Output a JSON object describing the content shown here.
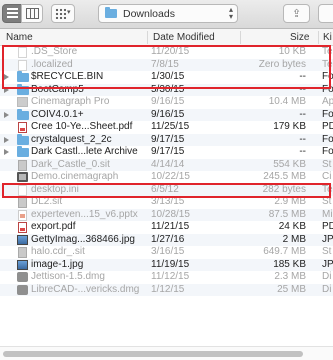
{
  "toolbar": {
    "location": "Downloads"
  },
  "columns": {
    "name": "Name",
    "date": "Date Modified",
    "size": "Size",
    "kind": "Ki"
  },
  "rows": [
    {
      "name": ".DS_Store",
      "date": "11/20/15",
      "size": "10 KB",
      "kind": "Te",
      "icon": "document-icon",
      "dim": true
    },
    {
      "name": ".localized",
      "date": "7/8/15",
      "size": "Zero bytes",
      "kind": "Te",
      "icon": "document-icon",
      "dim": true
    },
    {
      "name": "$RECYCLE.BIN",
      "date": "1/30/15",
      "size": "--",
      "kind": "Fo",
      "icon": "folder-icon",
      "dim": false,
      "folder": true
    },
    {
      "name": "BootCamp5",
      "date": "5/30/15",
      "size": "--",
      "kind": "Fo",
      "icon": "folder-icon",
      "dim": false,
      "folder": true
    },
    {
      "name": "Cinemagraph Pro",
      "date": "9/16/15",
      "size": "10.4 MB",
      "kind": "Ap",
      "icon": "app-icon",
      "dim": true
    },
    {
      "name": "COIV4.0.1+",
      "date": "9/16/15",
      "size": "--",
      "kind": "Fo",
      "icon": "folder-icon",
      "dim": false,
      "folder": true
    },
    {
      "name": "Cree 10-Ye...Sheet.pdf",
      "date": "11/25/15",
      "size": "179 KB",
      "kind": "PD",
      "icon": "pdf-icon",
      "dim": false
    },
    {
      "name": "crystalquest_2_2c",
      "date": "9/17/15",
      "size": "--",
      "kind": "Fo",
      "icon": "folder-icon",
      "dim": false,
      "folder": true
    },
    {
      "name": "Dark Castl...lete Archive",
      "date": "9/17/15",
      "size": "--",
      "kind": "Fo",
      "icon": "folder-icon",
      "dim": false,
      "folder": true
    },
    {
      "name": "Dark_Castle_0.sit",
      "date": "4/14/14",
      "size": "554 KB",
      "kind": "St",
      "icon": "archive-icon",
      "dim": true
    },
    {
      "name": "Demo.cinemagraph",
      "date": "10/22/15",
      "size": "245.5 MB",
      "kind": "Ci",
      "icon": "movie-icon",
      "dim": true
    },
    {
      "name": "desktop.ini",
      "date": "6/5/12",
      "size": "282 bytes",
      "kind": "Te",
      "icon": "document-icon",
      "dim": true
    },
    {
      "name": "DL2.sit",
      "date": "3/13/15",
      "size": "2.9 MB",
      "kind": "St",
      "icon": "archive-icon",
      "dim": true
    },
    {
      "name": "experteven...15_v6.pptx",
      "date": "10/28/15",
      "size": "87.5 MB",
      "kind": "Mi",
      "icon": "presentation-icon",
      "dim": true
    },
    {
      "name": "export.pdf",
      "date": "11/21/15",
      "size": "24 KB",
      "kind": "PD",
      "icon": "pdf-icon",
      "dim": false
    },
    {
      "name": "GettyImag...368466.jpg",
      "date": "1/27/16",
      "size": "2 MB",
      "kind": "JP",
      "icon": "image-icon",
      "dim": false
    },
    {
      "name": "halo.cdr_.sit",
      "date": "3/16/15",
      "size": "649.7 MB",
      "kind": "St",
      "icon": "archive-icon",
      "dim": true
    },
    {
      "name": "image-1.jpg",
      "date": "11/19/15",
      "size": "185 KB",
      "kind": "JP",
      "icon": "image-icon",
      "dim": false
    },
    {
      "name": "Jettison-1.5.dmg",
      "date": "11/12/15",
      "size": "2.3 MB",
      "kind": "Di",
      "icon": "disk-image-icon",
      "dim": true
    },
    {
      "name": "LibreCAD-...vericks.dmg",
      "date": "1/12/15",
      "size": "25 MB",
      "kind": "Di",
      "icon": "disk-image-icon",
      "dim": true
    }
  ]
}
